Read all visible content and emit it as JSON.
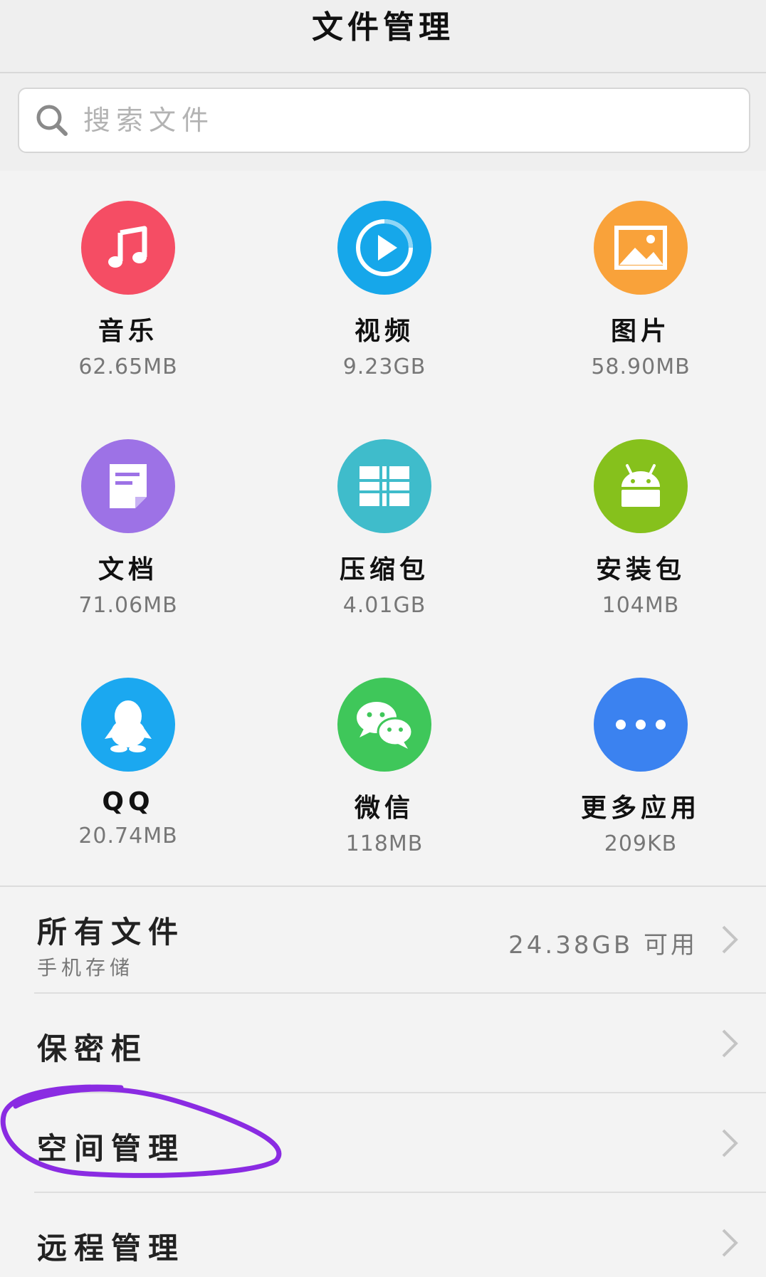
{
  "header": {
    "title": "文件管理"
  },
  "search": {
    "placeholder": "搜索文件"
  },
  "categories": [
    {
      "label": "音乐",
      "size": "62.65MB",
      "icon": "music-note-icon",
      "color": "#f54d64"
    },
    {
      "label": "视频",
      "size": "9.23GB",
      "icon": "play-icon",
      "color": "#16a7ea"
    },
    {
      "label": "图片",
      "size": "58.90MB",
      "icon": "image-icon",
      "color": "#f9a23a"
    },
    {
      "label": "文档",
      "size": "71.06MB",
      "icon": "document-icon",
      "color": "#9d72e6"
    },
    {
      "label": "压缩包",
      "size": "4.01GB",
      "icon": "archive-icon",
      "color": "#3fbccb"
    },
    {
      "label": "安装包",
      "size": "104MB",
      "icon": "android-icon",
      "color": "#86c11c"
    },
    {
      "label": "QQ",
      "size": "20.74MB",
      "icon": "qq-penguin-icon",
      "color": "#1ba8f0"
    },
    {
      "label": "微信",
      "size": "118MB",
      "icon": "wechat-icon",
      "color": "#3fc75a"
    },
    {
      "label": "更多应用",
      "size": "209KB",
      "icon": "more-dots-icon",
      "color": "#3b82f0"
    }
  ],
  "list": {
    "all_files": {
      "title": "所有文件",
      "subtitle": "手机存储",
      "available": "24.38GB 可用"
    },
    "safe": {
      "title": "保密柜"
    },
    "space": {
      "title": "空间管理"
    },
    "remote": {
      "title": "远程管理"
    }
  },
  "colors": {
    "annotation": "#8a2be2",
    "chevron": "#c4c4c4"
  }
}
